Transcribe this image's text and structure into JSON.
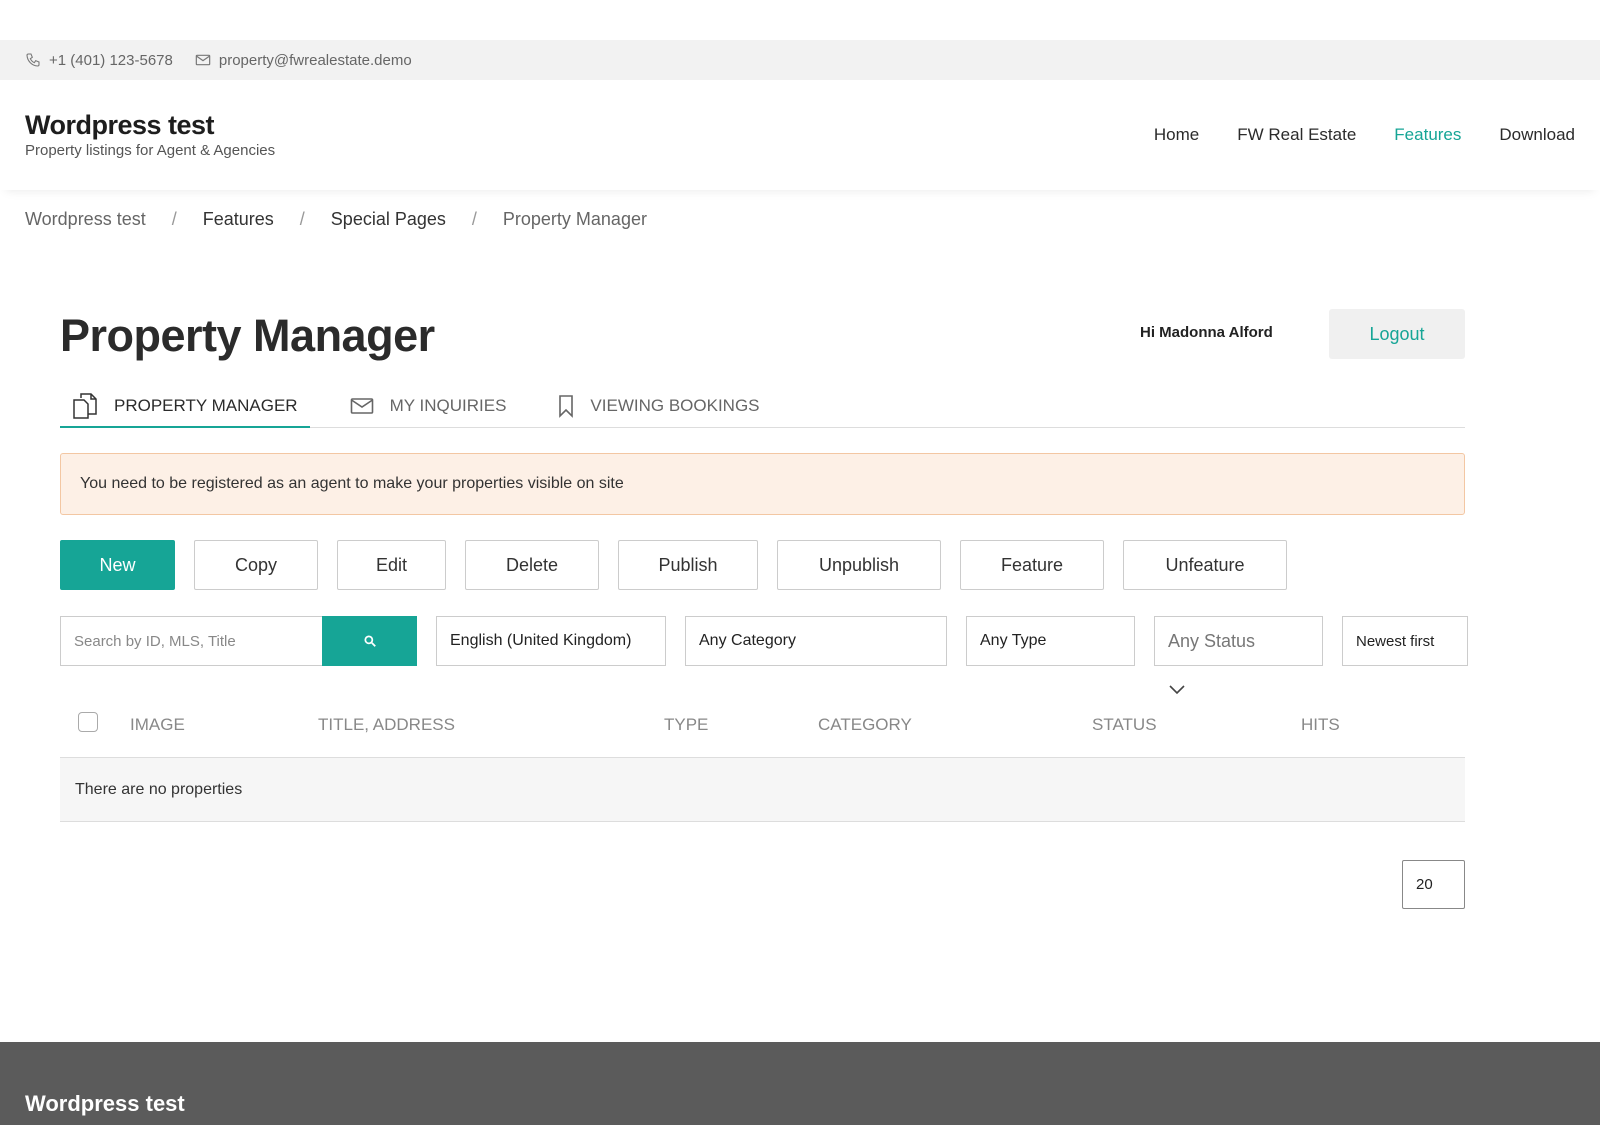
{
  "topbar": {
    "phone": "+1 (401) 123-5678",
    "email": "property@fwrealestate.demo"
  },
  "header": {
    "site_title": "Wordpress test",
    "tagline": "Property listings for Agent & Agencies",
    "nav": [
      "Home",
      "FW Real Estate",
      "Features",
      "Download"
    ],
    "nav_active": "Features"
  },
  "breadcrumb": [
    "Wordpress test",
    "Features",
    "Special Pages",
    "Property Manager"
  ],
  "page": {
    "title": "Property Manager",
    "greeting": "Hi Madonna Alford",
    "logout_label": "Logout"
  },
  "tabs": [
    "PROPERTY MANAGER",
    "MY INQUIRIES",
    "VIEWING BOOKINGS"
  ],
  "alert": "You need to be registered as an agent to make your properties visible on site",
  "actions": [
    "New",
    "Copy",
    "Edit",
    "Delete",
    "Publish",
    "Unpublish",
    "Feature",
    "Unfeature"
  ],
  "filters": {
    "search_placeholder": "Search by ID, MLS, Title",
    "language": "English (United Kingdom)",
    "category": "Any Category",
    "type": "Any Type",
    "status": "Any Status",
    "sort": "Newest first"
  },
  "table": {
    "columns": [
      "IMAGE",
      "TITLE, ADDRESS",
      "TYPE",
      "CATEGORY",
      "STATUS",
      "HITS"
    ],
    "empty_message": "There are no properties"
  },
  "pagination": {
    "per_page": "20"
  },
  "footer": {
    "title": "Wordpress test"
  },
  "colors": {
    "accent": "#16a596",
    "alert_bg": "#fdf0e6",
    "footer_bg": "#5b5b5b"
  }
}
